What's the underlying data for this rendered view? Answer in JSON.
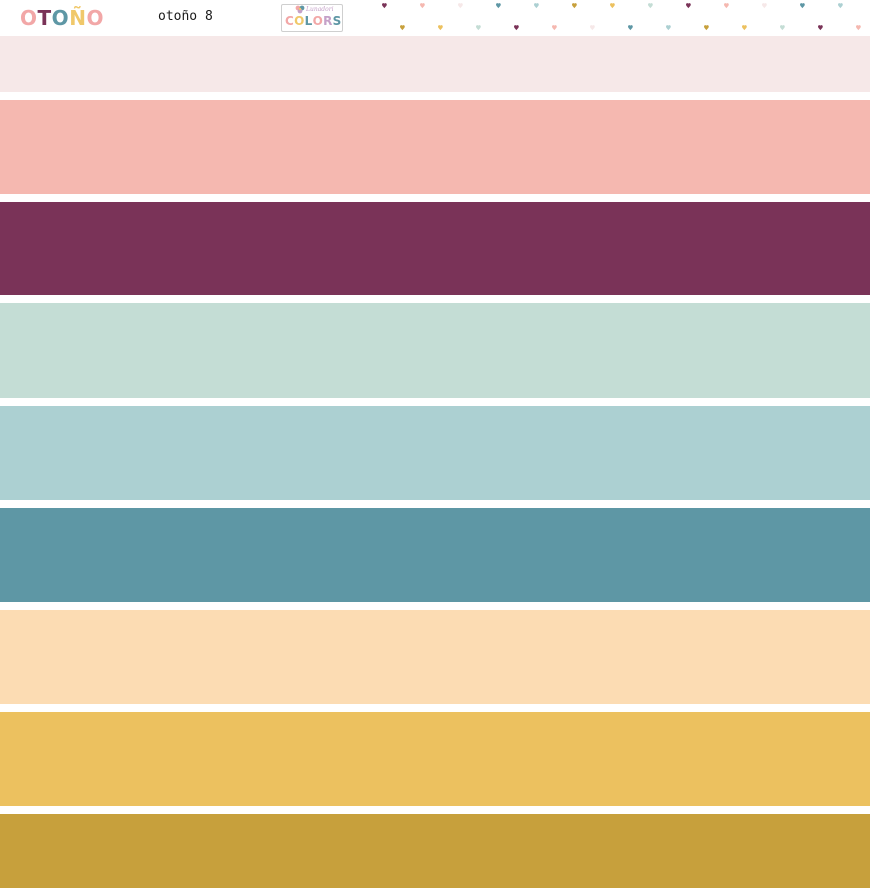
{
  "header": {
    "title": "OTOÑO",
    "title_letter_colors": [
      "#f2a7a7",
      "#7a3358",
      "#5e97a5",
      "#f0c86a",
      "#f2a7a7"
    ],
    "subtitle": "otoño 8",
    "logo": {
      "script": "Lunadori",
      "word": "COLORS",
      "word_letter_colors": [
        "#f2a7a7",
        "#f0c86a",
        "#5e97a5",
        "#f2a7a7",
        "#c5a1c8",
        "#5e97a5"
      ],
      "icon": "flower-icon"
    },
    "heart_colors": [
      "#7a3358",
      "#f5b8b0",
      "#f6e8e8",
      "#5e97a5",
      "#acd0d2",
      "#c7a03c",
      "#ecc15f",
      "#c4ddd5"
    ]
  },
  "palette": [
    {
      "color": "#f6e8e8"
    },
    {
      "color": "#f5b8b0"
    },
    {
      "color": "#7a3358"
    },
    {
      "color": "#c4ddd5"
    },
    {
      "color": "#acd0d2"
    },
    {
      "color": "#5e97a5"
    },
    {
      "color": "#fcdcb3"
    },
    {
      "color": "#ecc15f"
    },
    {
      "color": "#c7a03c"
    }
  ]
}
